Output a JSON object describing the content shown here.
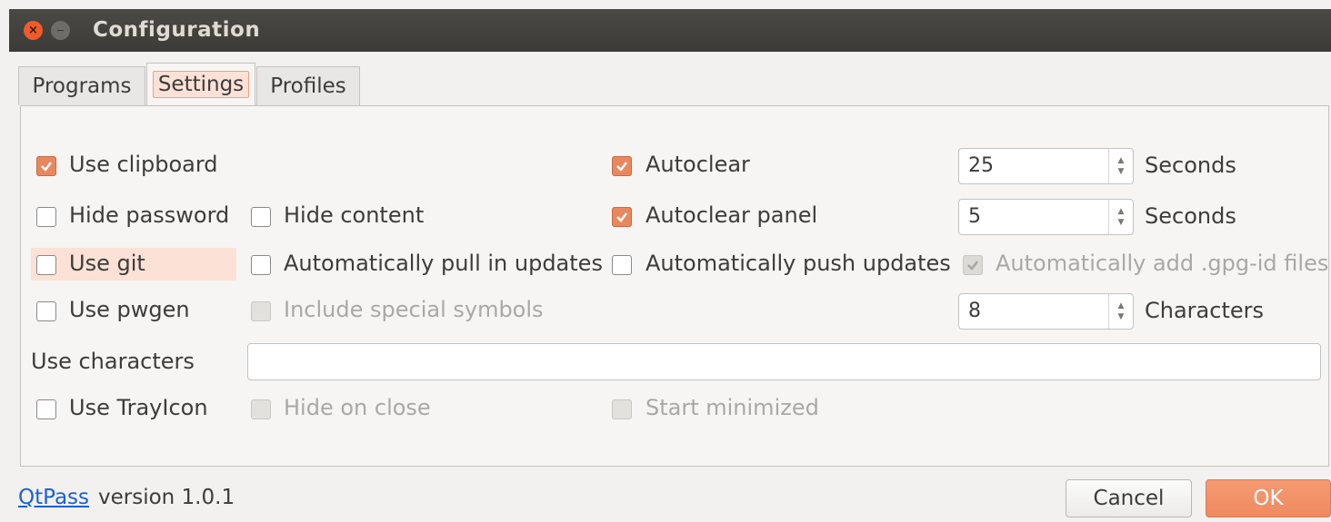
{
  "window": {
    "title": "Configuration"
  },
  "tabs": [
    "Programs",
    "Settings",
    "Profiles"
  ],
  "active_tab": "Settings",
  "settings": {
    "use_clipboard": {
      "label": "Use clipboard",
      "checked": true
    },
    "autoclear": {
      "label": "Autoclear",
      "checked": true,
      "value": "25",
      "unit": "Seconds"
    },
    "hide_password": {
      "label": "Hide password",
      "checked": false
    },
    "hide_content": {
      "label": "Hide content",
      "checked": false
    },
    "autoclear_panel": {
      "label": "Autoclear panel",
      "checked": true,
      "value": "5",
      "unit": "Seconds"
    },
    "use_git": {
      "label": "Use git",
      "checked": false
    },
    "auto_pull": {
      "label": "Automatically pull in updates",
      "checked": false
    },
    "auto_push": {
      "label": "Automatically push updates",
      "checked": false
    },
    "auto_add_gpg": {
      "label": "Automatically add .gpg-id files",
      "checked": true,
      "disabled": true
    },
    "use_pwgen": {
      "label": "Use pwgen",
      "checked": false
    },
    "include_special": {
      "label": "Include special symbols",
      "checked": false,
      "disabled": true
    },
    "password_length": {
      "value": "8",
      "unit": "Characters"
    },
    "use_characters": {
      "label": "Use characters",
      "value": ""
    },
    "use_trayicon": {
      "label": "Use TrayIcon",
      "checked": false
    },
    "hide_on_close": {
      "label": "Hide on close",
      "checked": false,
      "disabled": true
    },
    "start_minimized": {
      "label": "Start minimized",
      "checked": false,
      "disabled": true
    }
  },
  "footer": {
    "link": "QtPass",
    "version": "version 1.0.1",
    "cancel": "Cancel",
    "ok": "OK"
  },
  "colors": {
    "accent": "#e9875f",
    "titlebar": "#3c3b37",
    "link": "#1a5fd8"
  }
}
